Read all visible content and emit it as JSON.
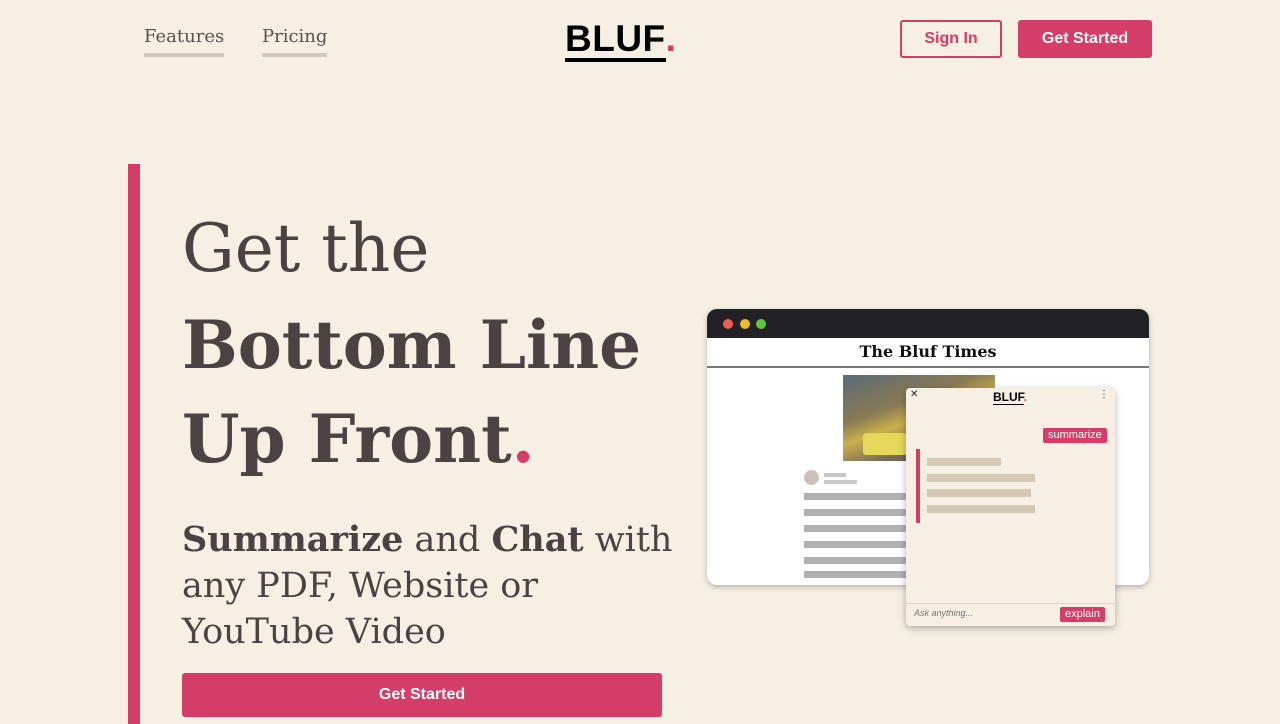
{
  "nav": {
    "features": "Features",
    "pricing": "Pricing",
    "logo_word": "BLUF",
    "logo_dot": ".",
    "sign_in": "Sign In",
    "get_started": "Get Started"
  },
  "hero": {
    "line1": "Get the",
    "line2": "Bottom Line",
    "line3": "Up Front",
    "line3_dot": ".",
    "sub_summarize": "Summarize",
    "sub_and": " and ",
    "sub_chat": "Chat",
    "sub_rest": " with any PDF, Website or YouTube Video",
    "cta": "Get Started"
  },
  "mockup": {
    "masthead": "The Bluf Times",
    "popup": {
      "close": "✕",
      "menu": "⋮",
      "logo_word": "BLUF",
      "logo_dot": ".",
      "summarize": "summarize",
      "input_placeholder": "Ask anything...",
      "explain": "explain"
    }
  },
  "colors": {
    "accent": "#d43d67",
    "background": "#f5efe4",
    "text": "#4b4342"
  }
}
